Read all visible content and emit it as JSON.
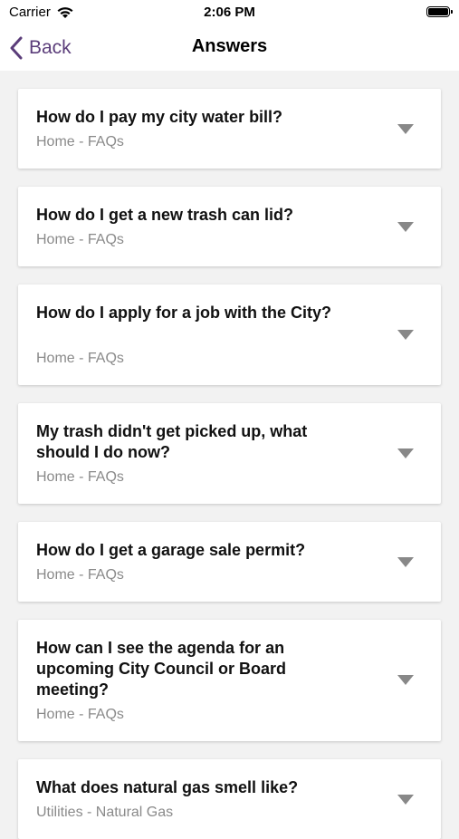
{
  "status": {
    "carrier": "Carrier",
    "time": "2:06 PM"
  },
  "nav": {
    "back_label": "Back",
    "title": "Answers"
  },
  "accent_color": "#5b3d7a",
  "items": [
    {
      "question": "How do I pay my city water bill?",
      "category": "Home - FAQs"
    },
    {
      "question": "How do I get a new trash can lid?",
      "category": "Home - FAQs"
    },
    {
      "question": "How do I apply for a job with the City?",
      "category": "Home - FAQs"
    },
    {
      "question": "My trash didn't get picked up, what should I do now?",
      "category": "Home - FAQs"
    },
    {
      "question": "How do I get a garage sale permit?",
      "category": "Home - FAQs"
    },
    {
      "question": "How can I see the agenda for an upcoming City Council or Board meeting?",
      "category": "Home - FAQs"
    },
    {
      "question": "What does natural gas smell like?",
      "category": "Utilities - Natural Gas"
    }
  ]
}
